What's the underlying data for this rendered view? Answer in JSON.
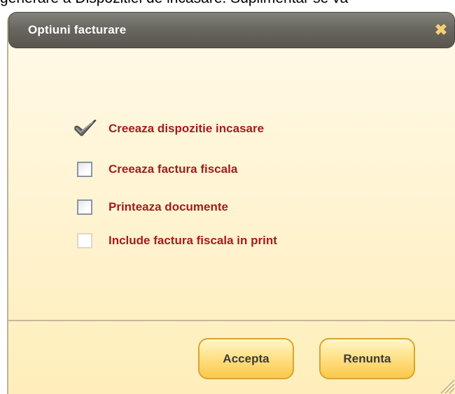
{
  "background": {
    "text": "generare a Dispozitiei de incasare. Suplimentar se va"
  },
  "dialog": {
    "title": "Optiuni facturare",
    "close_icon": "close-icon",
    "options": [
      {
        "label": "Creeaza dispozitie incasare",
        "checked": true,
        "enabled": true
      },
      {
        "label": "Creeaza factura fiscala",
        "checked": false,
        "enabled": true
      },
      {
        "label": "Printeaza documente",
        "checked": false,
        "enabled": true
      },
      {
        "label": "Include factura fiscala in print",
        "checked": false,
        "enabled": false
      }
    ],
    "buttons": {
      "accept": "Accepta",
      "cancel": "Renunta"
    }
  },
  "colors": {
    "title_bar": "#6a6761",
    "dialog_bg": "#fff3cf",
    "label_text": "#a31d1d",
    "button_bg": "#ffe28a",
    "close_icon": "#f4d074"
  }
}
